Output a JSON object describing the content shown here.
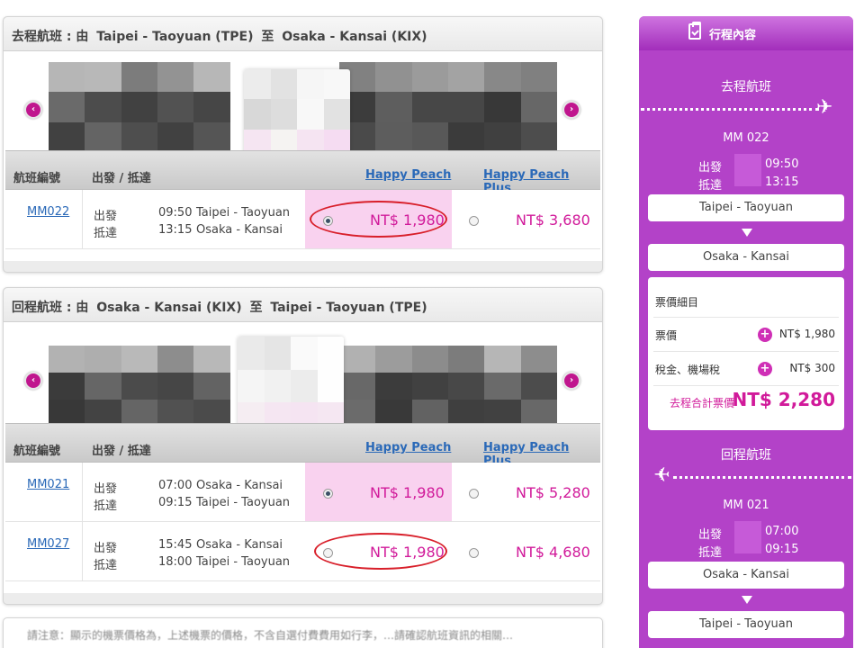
{
  "outbound": {
    "title": {
      "prefix": "去程航班 : 由",
      "from": "Taipei - Taoyuan (TPE)",
      "mid": "至",
      "to": "Osaka - Kansai (KIX)"
    },
    "headers": {
      "flight_no": "航班編號",
      "dep_arr": "出發 / 抵達",
      "happy_peach": "Happy Peach",
      "happy_peach_plus": "Happy Peach Plus"
    },
    "flights": [
      {
        "number": "MM022",
        "dep_label": "出發",
        "arr_label": "抵達",
        "dep_time": "09:50",
        "dep_place": "Taipei - Taoyuan",
        "arr_time": "13:15",
        "arr_place": "Osaka - Kansai",
        "hp_price": "NT$ 1,980",
        "hpp_price": "NT$ 3,680",
        "hp_selected": true
      }
    ]
  },
  "inbound": {
    "title": {
      "prefix": "回程航班 : 由",
      "from": "Osaka - Kansai (KIX)",
      "mid": "至",
      "to": "Taipei - Taoyuan (TPE)"
    },
    "headers": {
      "flight_no": "航班編號",
      "dep_arr": "出發 / 抵達",
      "happy_peach": "Happy Peach",
      "happy_peach_plus": "Happy Peach Plus"
    },
    "flights": [
      {
        "number": "MM021",
        "dep_label": "出發",
        "arr_label": "抵達",
        "dep_time": "07:00",
        "dep_place": "Osaka - Kansai",
        "arr_time": "09:15",
        "arr_place": "Taipei - Taoyuan",
        "hp_price": "NT$ 1,980",
        "hpp_price": "NT$ 5,280",
        "hp_selected": true
      },
      {
        "number": "MM027",
        "dep_label": "出發",
        "arr_label": "抵達",
        "dep_time": "15:45",
        "dep_place": "Osaka - Kansai",
        "arr_time": "18:00",
        "arr_place": "Taipei - Taoyuan",
        "hp_price": "NT$ 1,980",
        "hpp_price": "NT$ 4,680",
        "hp_selected": false
      }
    ]
  },
  "bottom_note": "請注意：顯示的機票價格為，上述機票的價格，不含自選付費費用如行李，…請確認航班資訊的相關…",
  "sidebar": {
    "title": "行程內容",
    "outbound": {
      "label": "去程航班",
      "flight": "MM 022",
      "dep_label": "出發",
      "dep_time": "09:50",
      "arr_label": "抵達",
      "arr_time": "13:15",
      "from": "Taipei - Taoyuan",
      "to": "Osaka - Kansai"
    },
    "fare": {
      "title": "票價細目",
      "fare_label": "票價",
      "fare_value": "NT$ 1,980",
      "tax_label": "稅金、機場稅",
      "tax_value": "NT$ 300",
      "total_label": "去程合計票價",
      "total_value": "NT$ 2,280"
    },
    "inbound": {
      "label": "回程航班",
      "flight": "MM 021",
      "dep_label": "出發",
      "dep_time": "07:00",
      "arr_label": "抵達",
      "arr_time": "09:15",
      "from": "Osaka - Kansai",
      "to": "Taipei - Taoyuan"
    }
  },
  "colors": {
    "accent": "#d11a9a",
    "sidebar": "#b342c8",
    "link": "#2a69b8",
    "selected_cell": "#f9d2ef",
    "annotation": "#d81f2a"
  },
  "icons": {
    "prev": "chevron-left-icon",
    "next": "chevron-right-icon",
    "plane_right": "airplane-right-icon",
    "plane_left": "airplane-left-icon",
    "clipboard": "clipboard-check-icon",
    "plus": "plus-circle-icon"
  }
}
